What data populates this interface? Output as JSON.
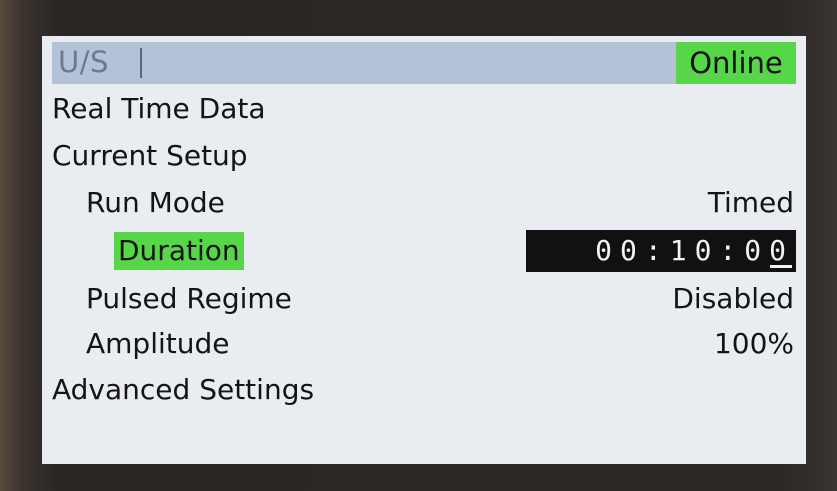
{
  "header": {
    "title": "U/S",
    "status": "Online"
  },
  "menu": {
    "real_time_data": "Real Time Data",
    "current_setup": "Current Setup",
    "run_mode": {
      "label": "Run Mode",
      "value": "Timed"
    },
    "duration": {
      "label": "Duration",
      "value": "00:10:00"
    },
    "pulsed_regime": {
      "label": "Pulsed Regime",
      "value": "Disabled"
    },
    "amplitude": {
      "label": "Amplitude",
      "value": "100%"
    },
    "advanced_settings": "Advanced Settings"
  },
  "colors": {
    "highlight": "#57d64a",
    "header_bg": "#b4c2d8",
    "screen_bg": "#e9ecf0",
    "edit_bg": "#111111"
  }
}
